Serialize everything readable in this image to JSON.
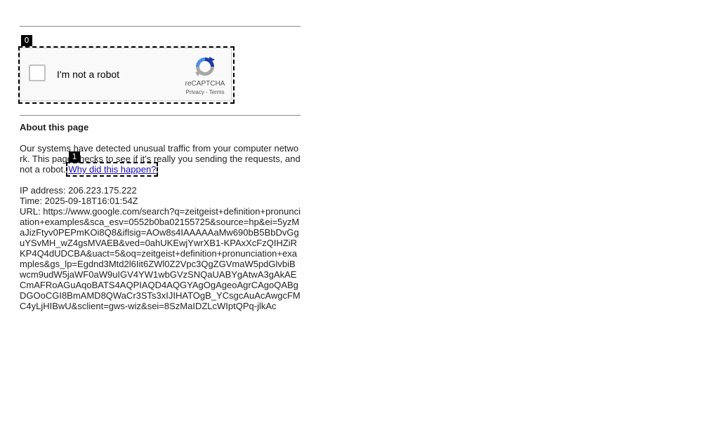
{
  "markers": [
    "0",
    "1"
  ],
  "captcha": {
    "label": "I'm not a robot",
    "brand": "reCAPTCHA",
    "privacy": "Privacy",
    "separator": " - ",
    "terms": "Terms"
  },
  "about": {
    "title": "About this page",
    "message": "Our systems have detected unusual traffic from your computer network. This page checks to see if it's really you sending the requests, and not a robot. ",
    "why_link": "Why did this happen?"
  },
  "details": {
    "ip": "IP address: 206.223.175.222",
    "time": "Time: 2025-09-18T16:01:54Z",
    "url": "URL: https://www.google.com/search?q=zeitgeist+definition+pronunciation+examples&sca_esv=0552b0ba02155725&source=hp&ei=5yzMaJizFtyv0PEPmKOi8Q8&iflsig=AOw8s4IAAAAAaMw690bB5BbDvGguYSvMH_wZ4gsMVAEB&ved=0ahUKEwjYwrXB1-KPAxXcFzQIHZiRKP4Q4dUDCBA&uact=5&oq=zeitgeist+definition+pronunciation+examples&gs_lp=Egdnd3Mtd2l6Iit6ZWl0Z2Vpc3QgZGVmaW5pdGlvbiBwcm9udW5jaWF0aW9uIGV4YW1wbGVzSNQaUABYgAtwA3gAkAECmAFRoAGuAqoBATS4AQPIAQD4AQGYAgOgAgeoAgrCAgoQABgDGOoCGI8BmAMD8QWaCr3STs3xIJIHATOgB_YCsgcAuAcAwgcFMC4yLjHIBwU&sclient=gws-wiz&sei=8SzMaIDZLcWIptQPq-jlkAc"
  },
  "colors": {
    "link": "#1a0dab",
    "text": "#222222",
    "divider": "#8a8a8a",
    "captcha_bg": "#f9f9f9",
    "captcha_blue": "#1c3aa9",
    "captcha_lightblue": "#4a90e2",
    "captcha_gray": "#a6a6a6"
  },
  "icons": {
    "checkbox": "checkbox-icon",
    "recaptcha_logo": "recaptcha-logo-icon"
  }
}
